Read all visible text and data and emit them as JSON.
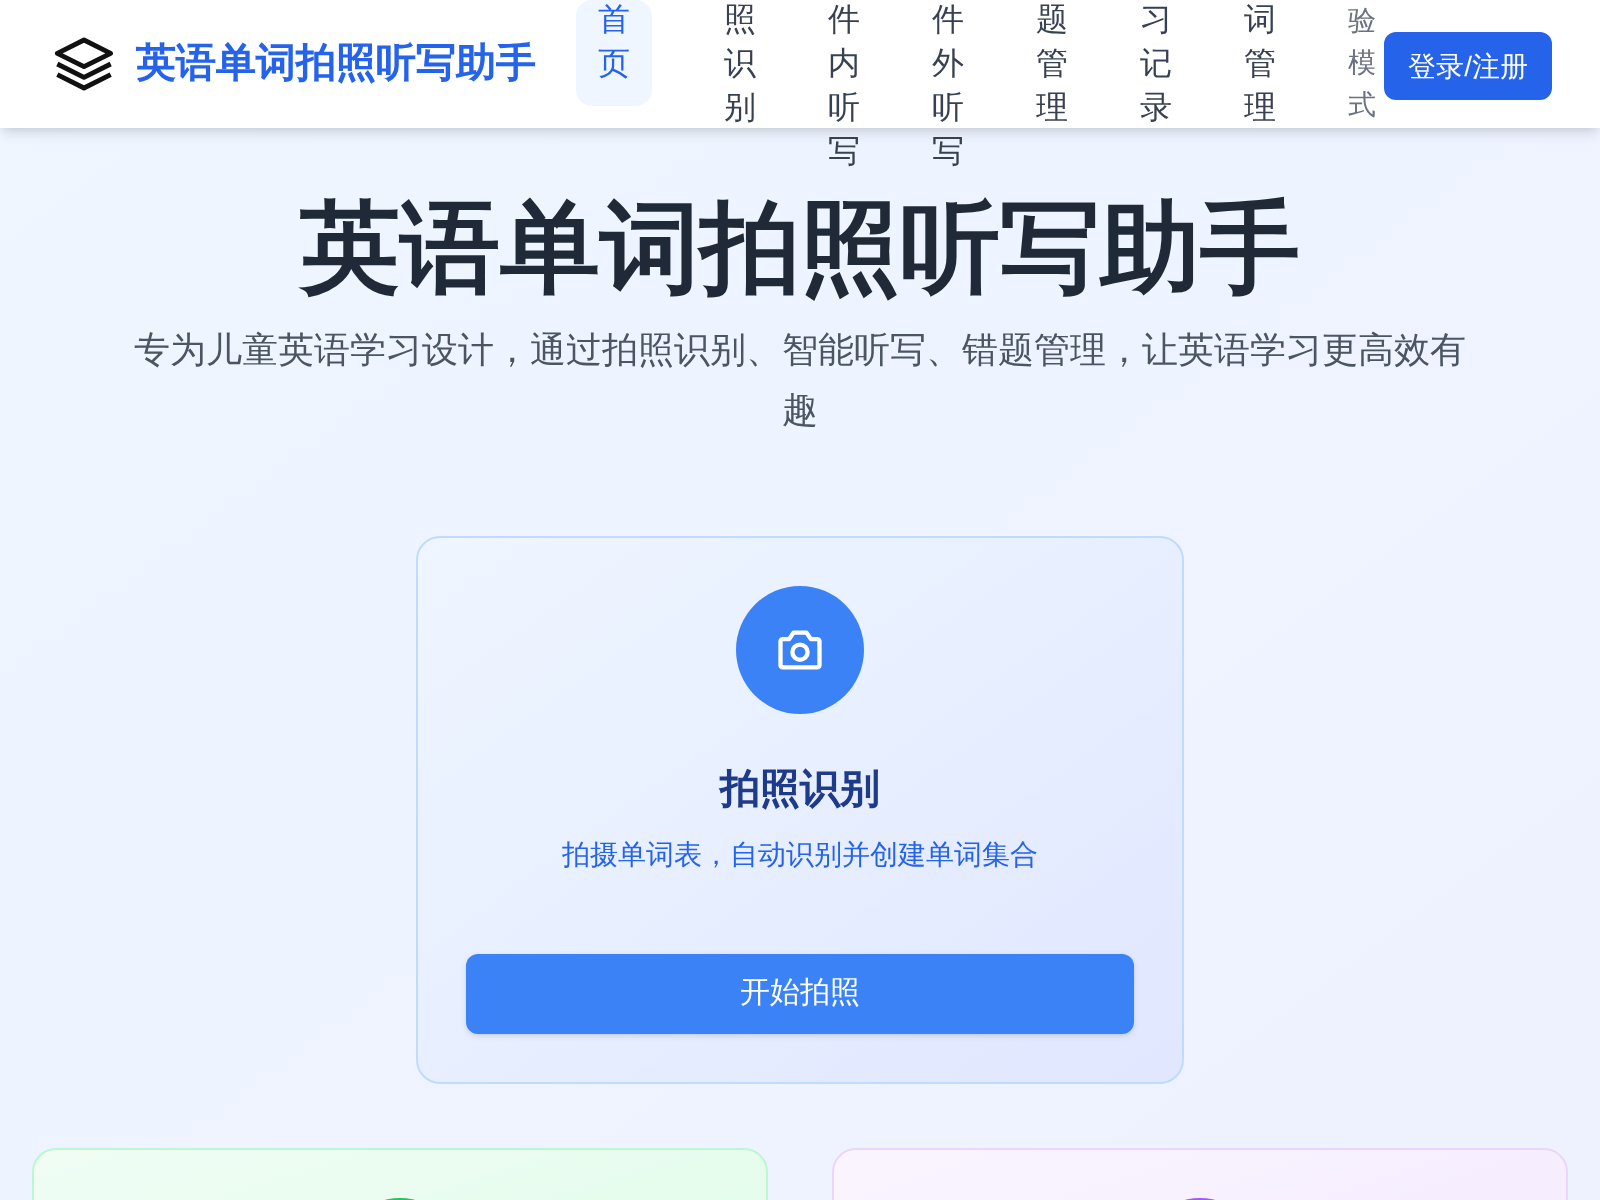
{
  "header": {
    "title": "英语单词拍照听写助手",
    "nav": [
      {
        "label": "首页",
        "selected": true,
        "kind": "link"
      },
      {
        "label": "照识别",
        "selected": false,
        "kind": "link"
      },
      {
        "label": "件内听写",
        "selected": false,
        "kind": "link"
      },
      {
        "label": "件外听写",
        "selected": false,
        "kind": "link"
      },
      {
        "label": "题管理",
        "selected": false,
        "kind": "link"
      },
      {
        "label": "习记录",
        "selected": false,
        "kind": "link"
      },
      {
        "label": "词管理",
        "selected": false,
        "kind": "link"
      },
      {
        "label": "验模式",
        "selected": false,
        "kind": "mode"
      }
    ],
    "login_button": "登录/注册"
  },
  "hero": {
    "title": "英语单词拍照听写助手",
    "subtitle": "专为儿童英语学习设计，通过拍照识别、智能听写、错题管理，让英语学习更高效有趣"
  },
  "features": [
    {
      "title": "拍照识别",
      "description": "拍摄单词表，自动识别并创建单词集合",
      "button": "开始拍照",
      "color": "#3b82f6"
    },
    {
      "color": "#22c55e"
    },
    {
      "color": "#a855f7"
    }
  ]
}
